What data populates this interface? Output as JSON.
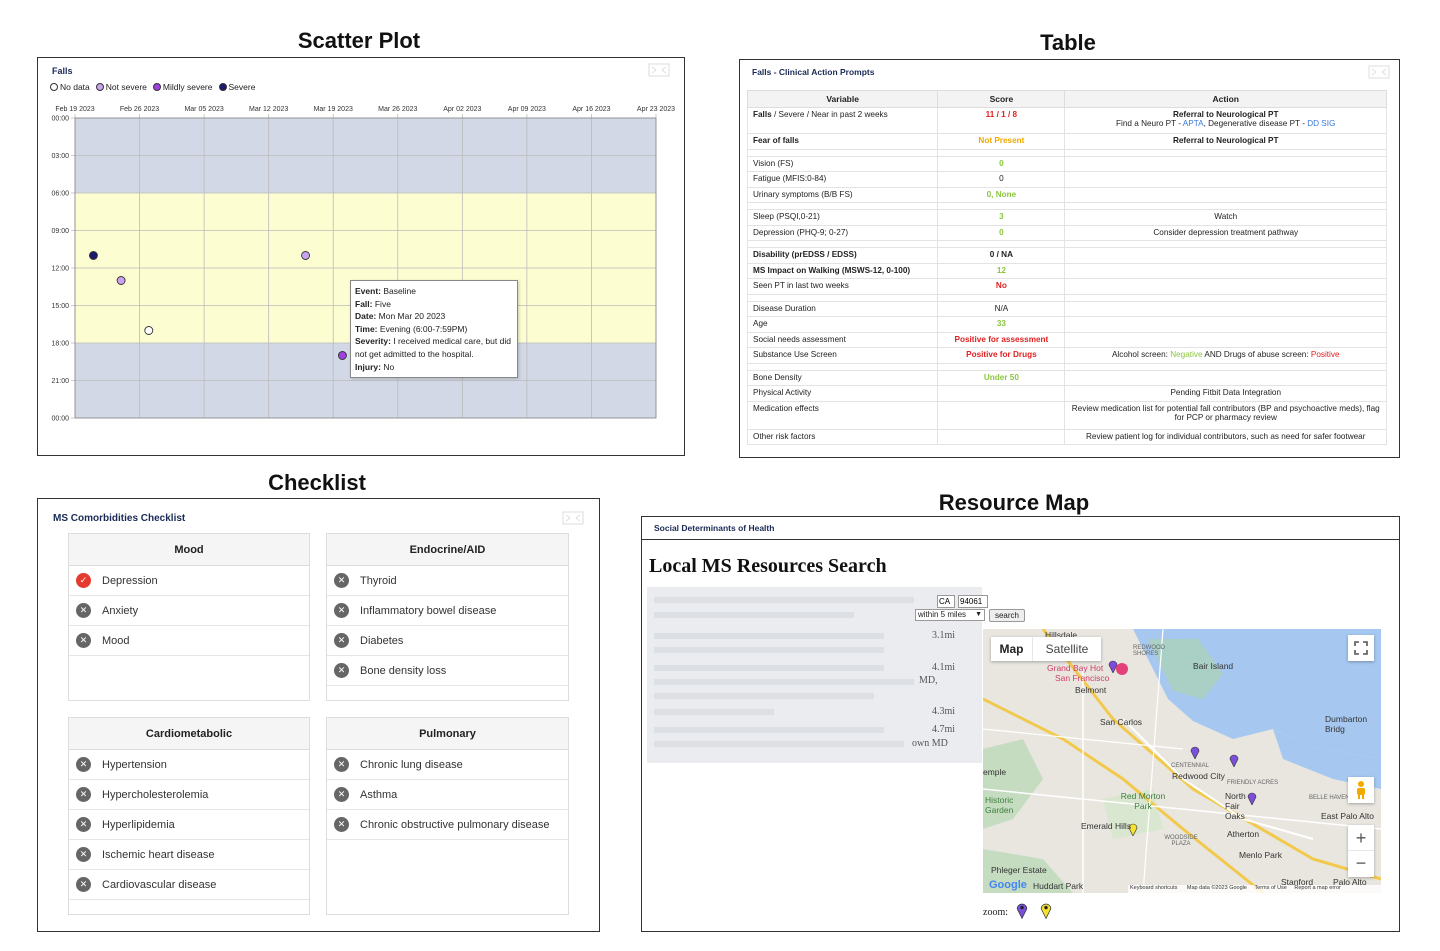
{
  "sections": {
    "scatter": "Scatter Plot",
    "table": "Table",
    "checklist": "Checklist",
    "map": "Resource Map"
  },
  "scatter": {
    "panel_title": "Falls",
    "legend": [
      {
        "label": "No data",
        "color": "#ffffff"
      },
      {
        "label": "Not severe",
        "color": "#c9a3f0"
      },
      {
        "label": "Mildly severe",
        "color": "#a040e0"
      },
      {
        "label": "Severe",
        "color": "#1a1a6e"
      }
    ],
    "tooltip": {
      "event_label": "Event:",
      "event": "Baseline",
      "fall_label": "Fall:",
      "fall": "Five",
      "date_label": "Date:",
      "date": "Mon Mar 20 2023",
      "time_label": "Time:",
      "time": "Evening (6:00-7:59PM)",
      "severity_label": "Severity:",
      "severity": "I received medical care, but did not get admitted to the hospital.",
      "injury_label": "Injury:",
      "injury": "No"
    }
  },
  "chart_data": {
    "type": "scatter",
    "title": "Falls",
    "x_ticks": [
      "Feb 19 2023",
      "Feb 26 2023",
      "Mar 05 2023",
      "Mar 12 2023",
      "Mar 19 2023",
      "Mar 26 2023",
      "Apr 02 2023",
      "Apr 09 2023",
      "Apr 16 2023",
      "Apr 23 2023"
    ],
    "y_ticks": [
      "00:00",
      "03:00",
      "06:00",
      "09:00",
      "12:00",
      "15:00",
      "18:00",
      "21:00",
      "00:00"
    ],
    "xlim": [
      "2023-02-19",
      "2023-04-23"
    ],
    "ylim_hours": [
      0,
      24
    ],
    "y_reversed": true,
    "bands": [
      {
        "from_hour": 0,
        "to_hour": 6,
        "color": "#d3d8e6"
      },
      {
        "from_hour": 6,
        "to_hour": 18,
        "color": "#fdfdd2"
      },
      {
        "from_hour": 18,
        "to_hour": 24,
        "color": "#d3d8e6"
      }
    ],
    "points": [
      {
        "date": "2023-02-21",
        "hour": 11,
        "severity": "Severe"
      },
      {
        "date": "2023-02-24",
        "hour": 13,
        "severity": "Not severe"
      },
      {
        "date": "2023-02-27",
        "hour": 17,
        "severity": "No data"
      },
      {
        "date": "2023-03-16",
        "hour": 11,
        "severity": "Not severe"
      },
      {
        "date": "2023-03-20",
        "hour": 19,
        "severity": "Mildly severe"
      }
    ]
  },
  "table": {
    "panel_title": "Falls - Clinical Action Prompts",
    "headers": [
      "Variable",
      "Score",
      "Action"
    ],
    "falls_var_bold": "Falls",
    "falls_var_rest": " / Severe / Near in past 2 weeks",
    "falls_score": "11 / 1 / 8",
    "falls_action_bold": "Referral to Neurological PT",
    "falls_action_a": "Find a Neuro PT - ",
    "falls_action_link1": "APTA",
    "falls_action_b": ", Degenerative disease PT - ",
    "falls_action_link2": "DD SIG",
    "fear_var": "Fear of falls",
    "fear_score": "Not Present",
    "fear_action": "Referral to Neurological PT",
    "vision_var": "Vision (FS)",
    "vision_score": "0",
    "fatigue_var": "Fatigue (MFIS:0-84)",
    "fatigue_score": "0",
    "urinary_var": "Urinary symptoms (B/B FS)",
    "urinary_score": "0, None",
    "sleep_var": "Sleep (PSQI,0-21)",
    "sleep_score": "3",
    "sleep_action": "Watch",
    "dep_var": "Depression (PHQ-9; 0-27)",
    "dep_score": "0",
    "dep_action": "Consider depression treatment pathway",
    "dis_var": "Disability (prEDSS / EDSS)",
    "dis_score": "0 / NA",
    "ms_var": "MS Impact on Walking (MSWS-12, 0-100)",
    "ms_score": "12",
    "pt_var": "Seen PT in last two weeks",
    "pt_score": "No",
    "dur_var": "Disease Duration",
    "dur_score": "N/A",
    "age_var": "Age",
    "age_score": "33",
    "social_var": "Social needs assessment",
    "social_score": "Positive for assessment",
    "sub_var": "Substance Use Screen",
    "sub_score": "Positive for Drugs",
    "sub_action_a": "Alcohol screen: ",
    "sub_action_neg": "Negative",
    "sub_action_b": " AND Drugs of abuse screen: ",
    "sub_action_pos": "Positive",
    "bone_var": "Bone Density",
    "bone_score": "Under 50",
    "pa_var": "Physical Activity",
    "pa_action": "Pending Fitbit Data Integration",
    "med_var": "Medication effects",
    "med_action": "Review medication list for potential fall contributors (BP and psychoactive meds), flag for PCP or pharmacy review",
    "other_var": "Other risk factors",
    "other_action": "Review patient log for individual contributors, such as need for safer footwear"
  },
  "checklist": {
    "panel_title": "MS Comorbidities Checklist",
    "mood": {
      "title": "Mood",
      "items": [
        "Depression",
        "Anxiety",
        "Mood"
      ]
    },
    "endo": {
      "title": "Endocrine/AID",
      "items": [
        "Thyroid",
        "Inflammatory bowel disease",
        "Diabetes",
        "Bone density loss"
      ]
    },
    "cardio": {
      "title": "Cardiometabolic",
      "items": [
        "Hypertension",
        "Hypercholesterolemia",
        "Hyperlipidemia",
        "Ischemic heart disease",
        "Cardiovascular disease"
      ]
    },
    "pulm": {
      "title": "Pulmonary",
      "items": [
        "Chronic lung disease",
        "Asthma",
        "Chronic obstructive pulmonary disease"
      ]
    }
  },
  "map": {
    "panel_title": "Social Determinants of Health",
    "heading": "Local MS Resources Search",
    "state": "CA",
    "zip": "94061",
    "radius": "within 5 miles",
    "search_label": "search",
    "tab_map": "Map",
    "tab_satellite": "Satellite",
    "results": [
      {
        "dist": "3.1mi"
      },
      {
        "dist": "4.1mi"
      },
      {
        "dist": "4.3mi"
      },
      {
        "dist": "4.7mi"
      }
    ],
    "ghost_tail1": "MD,",
    "ghost_tail2": "own MD",
    "labels": {
      "grand_bay": "Grand Bay Hot",
      "sf": "San Francisco",
      "belmont": "Belmont",
      "san_carlos": "San Carlos",
      "bair": "Bair Island",
      "dumbarton": "Dumbarton Bridg",
      "redwood": "Redwood City",
      "centennial": "CENTENNIAL",
      "friendly": "FRIENDLY ACRES",
      "red_morton": "Red Morton Park",
      "north_fair": "North Fair Oaks",
      "belle": "BELLE HAVEN",
      "east_palo": "East Palo Alto",
      "historic": "Historic Garden",
      "emerald": "Emerald Hills",
      "atherton": "Atherton",
      "woodside": "WOODSIDE PLAZA",
      "menlo": "Menlo Park",
      "phleger": "Phleger Estate",
      "huddart": "Huddart Park",
      "stanford": "Stanford",
      "palo_alto": "Palo Alto",
      "hillsdale": "Hillsdale",
      "redwood_shores": "REDWOOD SHORES",
      "temple": "emple",
      "google": "Google",
      "keyboard": "Keyboard shortcuts",
      "map_data": "Map data ©2023 Google",
      "terms": "Terms of Use",
      "report": "Report a map error"
    },
    "zoom_label": "zoom:"
  }
}
